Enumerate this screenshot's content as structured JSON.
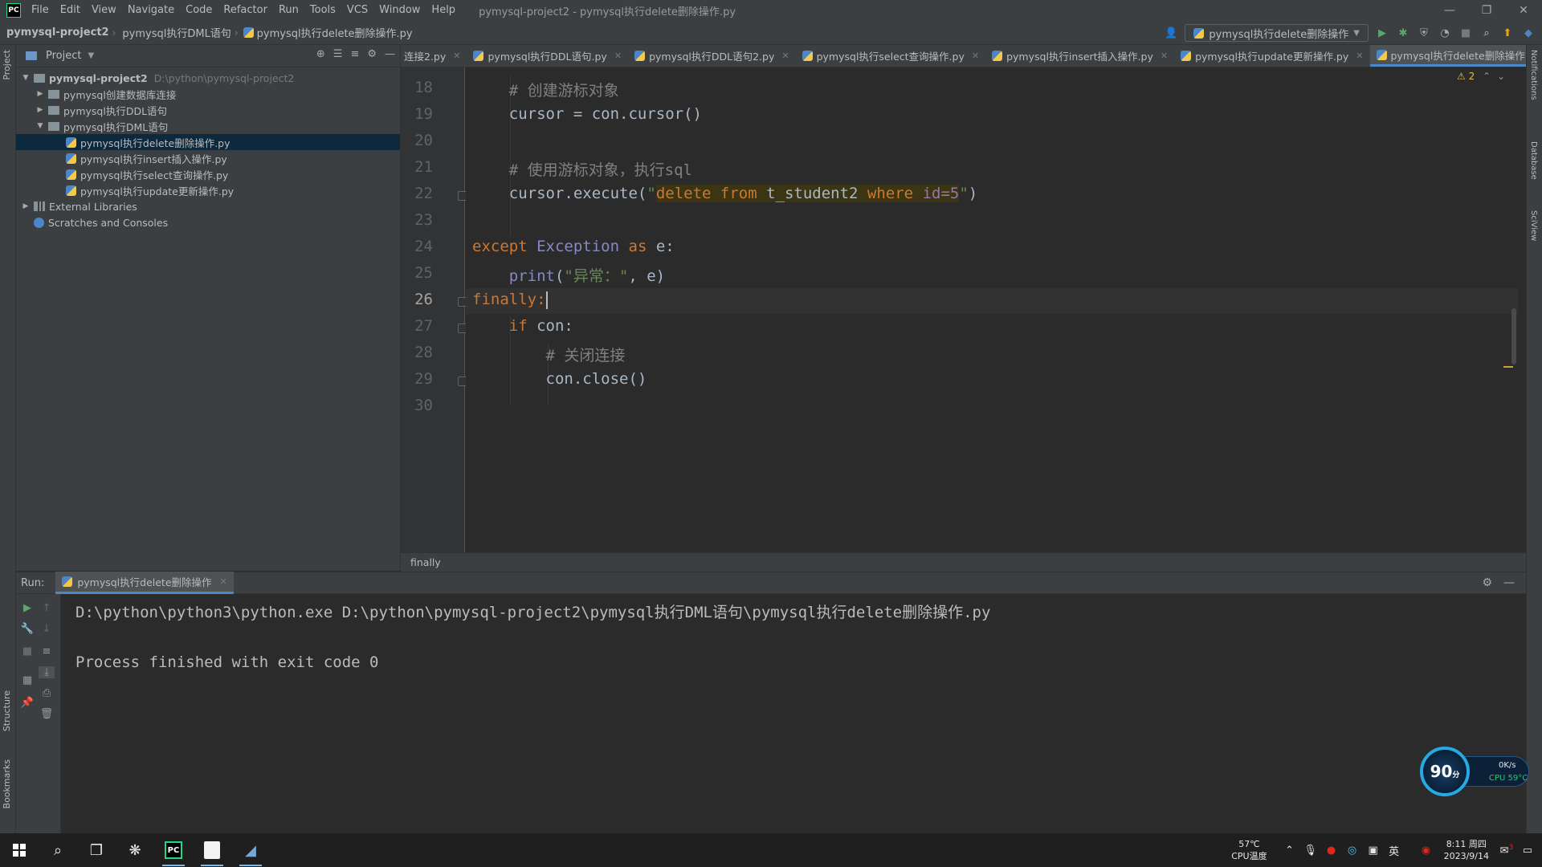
{
  "menubar": {
    "logo": "PC",
    "items": [
      "File",
      "Edit",
      "View",
      "Navigate",
      "Code",
      "Refactor",
      "Run",
      "Tools",
      "VCS",
      "Window",
      "Help"
    ],
    "window_title": "pymysql-project2 - pymysql执行delete删除操作.py"
  },
  "navbar": {
    "crumbs": [
      "pymysql-project2",
      "pymysql执行DML语句",
      "pymysql执行delete删除操作.py"
    ],
    "run_config": "pymysql执行delete删除操作"
  },
  "stripes": {
    "left_top": "Project",
    "left_structure": "Structure",
    "left_bookmarks": "Bookmarks",
    "right_notifications": "Notifications",
    "right_database": "Database",
    "right_sciview": "SciView"
  },
  "project_panel": {
    "title": "Project",
    "root_name": "pymysql-project2",
    "root_path": "D:\\python\\pymysql-project2",
    "items": [
      "pymysql创建数据库连接",
      "pymysql执行DDL语句",
      "pymysql执行DML语句",
      "pymysql执行delete删除操作.py",
      "pymysql执行insert插入操作.py",
      "pymysql执行select查询操作.py",
      "pymysql执行update更新操作.py",
      "External Libraries",
      "Scratches and Consoles"
    ]
  },
  "tabs": [
    "连接2.py",
    "pymysql执行DDL语句.py",
    "pymysql执行DDL语句2.py",
    "pymysql执行select查询操作.py",
    "pymysql执行insert插入操作.py",
    "pymysql执行update更新操作.py",
    "pymysql执行delete删除操作.py"
  ],
  "editor": {
    "warning_count": "2",
    "line_numbers": [
      "18",
      "19",
      "20",
      "21",
      "22",
      "23",
      "24",
      "25",
      "26",
      "27",
      "28",
      "29",
      "30"
    ],
    "current_line": "26",
    "code": {
      "l18": "# 创建游标对象",
      "l19": "cursor = con.cursor()",
      "l21": "# 使用游标对象，执行sql",
      "l22_a": "cursor.execute(",
      "l22_q1": "\"",
      "l22_s1": "delete from ",
      "l22_s2": "t_student2",
      "l22_s3": " where ",
      "l22_s4": "id=5",
      "l22_q2": "\"",
      "l22_b": ")",
      "l24_kw1": "except",
      "l24_cls": "Exception",
      "l24_kw2": "as",
      "l24_rest": "e:",
      "l25_fn": "print",
      "l25_a": "(",
      "l25_str": "\"异常：\"",
      "l25_b": ", e)",
      "l26": "finally:",
      "l27_kw": "if",
      "l27_rest": "con:",
      "l28": "# 关闭连接",
      "l29": "con.close()"
    },
    "breadcrumb": "finally"
  },
  "run": {
    "label": "Run:",
    "tab": "pymysql执行delete删除操作",
    "line1": "D:\\python\\python3\\python.exe D:\\python\\pymysql-project2\\pymysql执行DML语句\\pymysql执行delete删除操作.py",
    "line2": "Process finished with exit code 0"
  },
  "widget": {
    "score": "90",
    "score_unit": "分",
    "net": "0K/s",
    "cpu": "CPU 59°C"
  },
  "taskbar": {
    "temp": "57℃",
    "temp_label": "CPU温度",
    "ime": "英",
    "time": "8:11 周四",
    "date": "2023/9/14",
    "notif_count": "3"
  }
}
